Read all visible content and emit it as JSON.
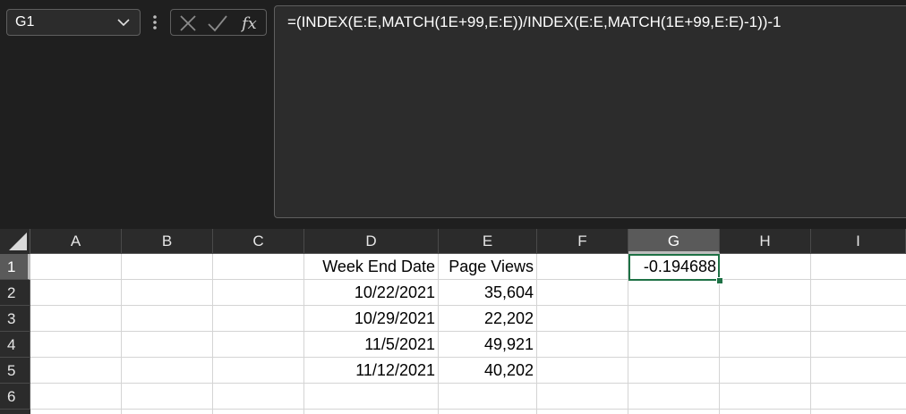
{
  "name_box": {
    "value": "G1"
  },
  "formula_bar": {
    "formula": "=(INDEX(E:E,MATCH(1E+99,E:E))/INDEX(E:E,MATCH(1E+99,E:E)-1))-1"
  },
  "icons": [
    "chevron-down-icon",
    "more-options-icon",
    "cancel-icon",
    "enter-check-icon",
    "insert-function-icon"
  ],
  "columns": [
    "A",
    "B",
    "C",
    "D",
    "E",
    "F",
    "G",
    "H",
    "I"
  ],
  "rows": [
    "1",
    "2",
    "3",
    "4",
    "5",
    "6"
  ],
  "selected": {
    "column": "G",
    "row": "1"
  },
  "cells": {
    "D1": "Week End Date",
    "E1": "Page Views",
    "G1": "-0.194688",
    "D2": "10/22/2021",
    "E2": "35,604",
    "D3": "10/29/2021",
    "E3": "22,202",
    "D4": "11/5/2021",
    "E4": "49,921",
    "D5": "11/12/2021",
    "E5": "40,202"
  },
  "colors": {
    "accent": "#1e7145",
    "background": "#1f1f1f",
    "header": "#2b2b2b"
  }
}
